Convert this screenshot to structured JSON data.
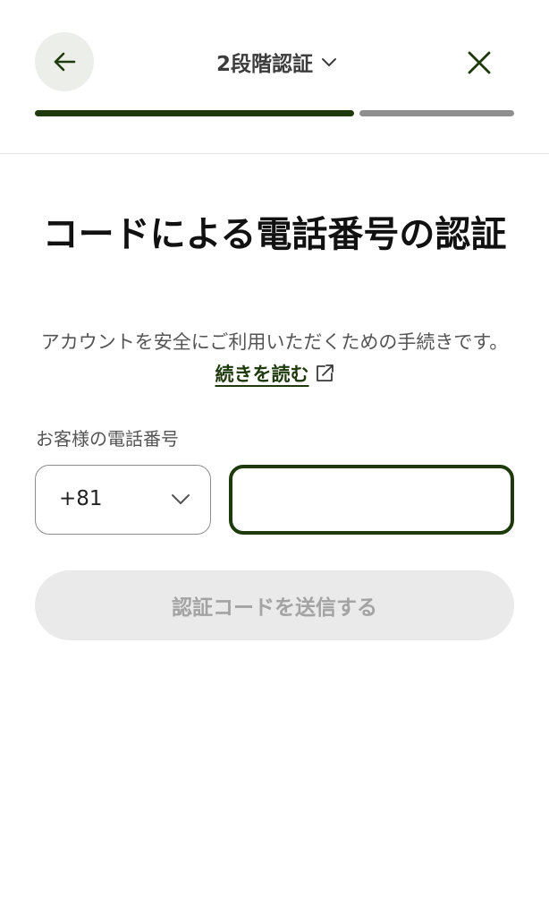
{
  "header": {
    "title": "2段階認証",
    "back_icon": "arrow-left-icon",
    "title_chevron_icon": "chevron-down-icon",
    "close_icon": "close-icon",
    "progress_percent": 67
  },
  "main": {
    "title": "コードによる電話番号の認証",
    "description": "アカウントを安全にご利用いただくための手続きです。",
    "read_more_label": "続きを読む",
    "read_more_icon": "external-link-icon",
    "phone_label": "お客様の電話番号",
    "country_code": "+81",
    "phone_value": "",
    "send_button_label": "認証コードを送信する"
  },
  "colors": {
    "accent": "#1e3a0c",
    "progress_remaining": "#8e8e8e",
    "back_button_bg": "#eceeea",
    "disabled_button_bg": "#eaeaea",
    "disabled_button_text": "#a3a3a3"
  }
}
